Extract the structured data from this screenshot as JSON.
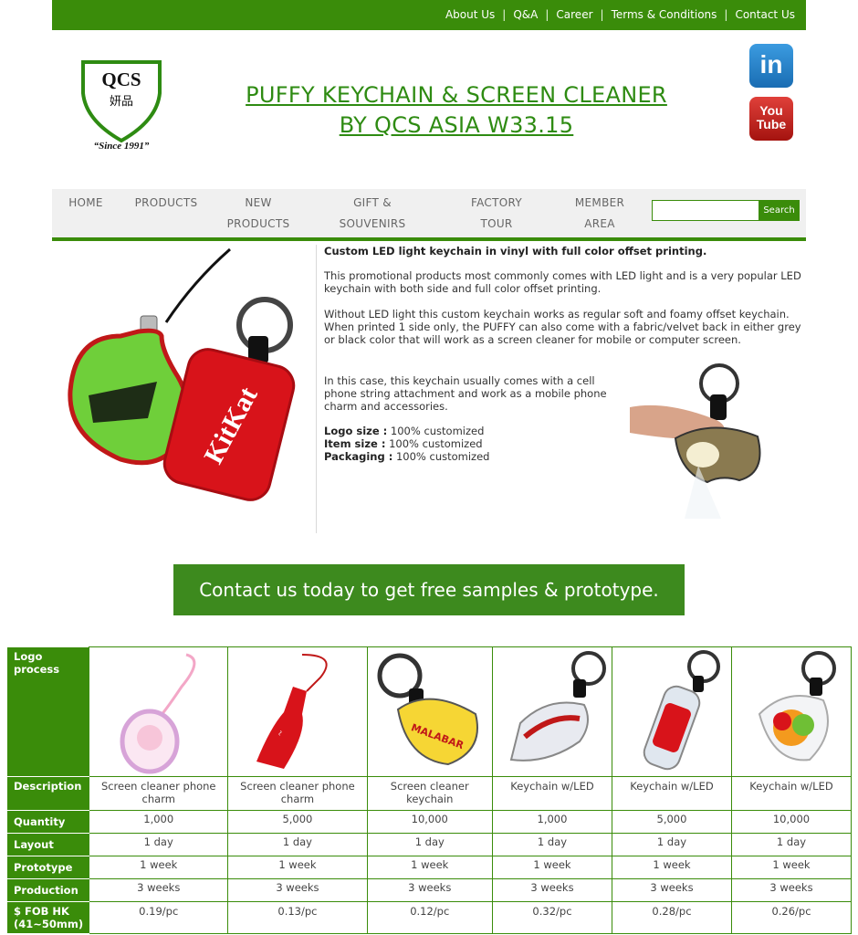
{
  "top_nav": {
    "links": [
      "About Us",
      "Q&A",
      "Career",
      "Terms & Conditions",
      "Contact Us"
    ]
  },
  "logo": {
    "text": "QCS",
    "chinese": "妍品",
    "since": "“Since 1991”"
  },
  "page_title": {
    "line1": "PUFFY KEYCHAIN & SCREEN CLEANER",
    "line2": "BY QCS ASIA W33.15"
  },
  "social": {
    "linkedin": "in",
    "youtube_top": "You",
    "youtube_bottom": "Tube"
  },
  "main_nav": {
    "home": "HOME",
    "products": "PRODUCTS",
    "new_1": "NEW",
    "new_2": "PRODUCTS",
    "gift_1": "GIFT &",
    "gift_2": "SOUVENIRS",
    "factory_1": "FACTORY",
    "factory_2": "TOUR",
    "member_1": "MEMBER",
    "member_2": "AREA",
    "search_button": "Search",
    "search_value": ""
  },
  "content": {
    "heading": "Custom LED light keychain in vinyl with full color offset printing.",
    "para1": "This promotional products most commonly comes with LED light and is a very popular LED keychain with both side and full color offset printing.",
    "para2": "Without LED light this custom keychain works as regular soft and foamy offset keychain. When printed 1 side only, the PUFFY can also come with a fabric/velvet back in either grey or black color that will work as a screen cleaner for mobile or computer screen.",
    "para3": "In this case, this keychain usually comes with a cell phone string attachment and work as a mobile phone charm and accessories.",
    "logo_size_label": "Logo size :",
    "logo_size_value": " 100% customized",
    "item_size_label": "Item size :",
    "item_size_value": " 100% customized",
    "packaging_label": "Packaging :",
    "packaging_value": " 100% customized",
    "kitkat_text": "KitKat"
  },
  "cta": {
    "label": "Contact us today to get free samples & prototype."
  },
  "table": {
    "row_labels": {
      "logo": "Logo process",
      "description": "Description",
      "quantity": "Quantity",
      "layout": "Layout",
      "prototype": "Prototype",
      "production": "Production",
      "fob": "$ FOB HK (41~50mm)"
    },
    "columns": [
      {
        "description": "Screen cleaner phone charm",
        "quantity": "1,000",
        "layout": "1 day",
        "prototype": "1 week",
        "production": "3 weeks",
        "fob": "0.19/pc"
      },
      {
        "description": "Screen cleaner phone charm",
        "quantity": "5,000",
        "layout": "1 day",
        "prototype": "1 week",
        "production": "3 weeks",
        "fob": "0.13/pc"
      },
      {
        "description": "Screen cleaner keychain",
        "quantity": "10,000",
        "layout": "1 day",
        "prototype": "1 week",
        "production": "3 weeks",
        "fob": "0.12/pc"
      },
      {
        "description": "Keychain w/LED",
        "quantity": "1,000",
        "layout": "1 day",
        "prototype": "1 week",
        "production": "3 weeks",
        "fob": "0.32/pc"
      },
      {
        "description": "Keychain w/LED",
        "quantity": "5,000",
        "layout": "1 day",
        "prototype": "1 week",
        "production": "3 weeks",
        "fob": "0.28/pc"
      },
      {
        "description": "Keychain w/LED",
        "quantity": "10,000",
        "layout": "1 day",
        "prototype": "1 week",
        "production": "3 weeks",
        "fob": "0.26/pc"
      }
    ],
    "image_labels": [
      "",
      "",
      "MALABAR",
      "",
      "",
      ""
    ]
  },
  "colors": {
    "brand_green": "#3a8c0a",
    "title_green": "#2e8b12",
    "cta_green": "#3d8a1e"
  }
}
